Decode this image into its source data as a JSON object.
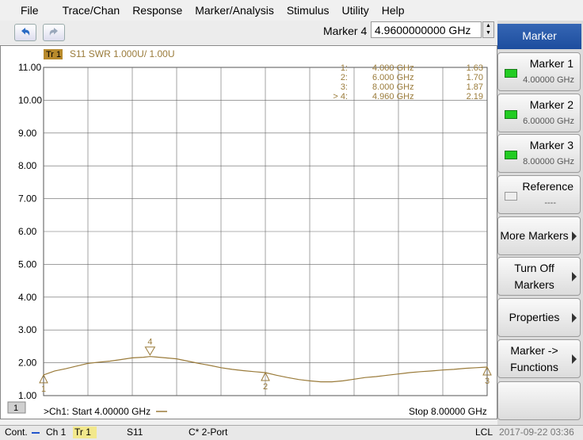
{
  "menu": [
    "File",
    "Trace/Chan",
    "Response",
    "Marker/Analysis",
    "Stimulus",
    "Utility",
    "Help"
  ],
  "toolbar": {
    "undo_icon": "undo-arrow-icon",
    "redo_icon": "redo-arrow-icon",
    "marker_label": "Marker 4",
    "marker_value": "4.9600000000 GHz"
  },
  "sidebar": {
    "title": "Marker",
    "buttons": [
      {
        "label": "Marker 1",
        "sub": "4.00000 GHz",
        "led": "on"
      },
      {
        "label": "Marker 2",
        "sub": "6.00000 GHz",
        "led": "on"
      },
      {
        "label": "Marker 3",
        "sub": "8.00000 GHz",
        "led": "on"
      },
      {
        "label": "Reference",
        "sub": "----",
        "led": "off"
      },
      {
        "label": "More Markers"
      },
      {
        "label": "Turn Off\nMarkers"
      },
      {
        "label": "Properties"
      },
      {
        "label": "Marker ->\nFunctions"
      },
      {
        "label": ""
      }
    ]
  },
  "trace": {
    "tag": "Tr 1",
    "description": "S11 SWR 1.000U/  1.00U",
    "channel_num": "1"
  },
  "marker_table": [
    {
      "id": "1:",
      "freq": "4.000 GHz",
      "val": "1.63"
    },
    {
      "id": "2:",
      "freq": "6.000 GHz",
      "val": "1.70"
    },
    {
      "id": "3:",
      "freq": "8.000 GHz",
      "val": "1.87"
    },
    {
      "id": "> 4:",
      "freq": "4.960 GHz",
      "val": "2.19"
    }
  ],
  "footer": {
    "start": ">Ch1:  Start  4.00000 GHz",
    "stop": "Stop  8.00000 GHz"
  },
  "status": {
    "mode": "Cont.",
    "ch": "Ch 1",
    "tr": "Tr 1",
    "param": "S11",
    "cal": "C* 2-Port",
    "lcl": "LCL",
    "time": "2017-09-22 03:36"
  },
  "chart_data": {
    "type": "line",
    "title": "",
    "xlabel": "",
    "ylabel": "",
    "xlim": [
      4.0,
      8.0
    ],
    "ylim": [
      1.0,
      11.0
    ],
    "yticks": [
      "11.00",
      "10.00",
      "9.00",
      "8.00",
      "7.00",
      "6.00",
      "5.00",
      "4.00",
      "3.00",
      "2.00",
      "1.00"
    ],
    "grid": true,
    "series": [
      {
        "x": [
          4.0,
          4.1,
          4.2,
          4.3,
          4.4,
          4.5,
          4.6,
          4.7,
          4.8,
          4.9,
          4.96,
          5.0,
          5.1,
          5.2,
          5.3,
          5.4,
          5.5,
          5.6,
          5.7,
          5.8,
          5.9,
          6.0,
          6.1,
          6.2,
          6.3,
          6.4,
          6.5,
          6.6,
          6.7,
          6.8,
          6.9,
          7.0,
          7.1,
          7.2,
          7.3,
          7.4,
          7.5,
          7.6,
          7.7,
          7.8,
          7.9,
          8.0
        ],
        "values": [
          1.63,
          1.75,
          1.82,
          1.9,
          1.98,
          2.02,
          2.05,
          2.1,
          2.15,
          2.17,
          2.19,
          2.18,
          2.15,
          2.12,
          2.05,
          1.98,
          1.92,
          1.85,
          1.8,
          1.76,
          1.73,
          1.7,
          1.62,
          1.55,
          1.49,
          1.45,
          1.42,
          1.42,
          1.45,
          1.5,
          1.55,
          1.58,
          1.62,
          1.66,
          1.7,
          1.73,
          1.75,
          1.78,
          1.8,
          1.83,
          1.85,
          1.87
        ]
      }
    ],
    "markers": [
      {
        "label": "1",
        "x": 4.0,
        "y": 1.63
      },
      {
        "label": "2",
        "x": 6.0,
        "y": 1.7
      },
      {
        "label": "3",
        "x": 8.0,
        "y": 1.87
      },
      {
        "label": "4",
        "x": 4.96,
        "y": 2.19
      }
    ],
    "trace_color": "#9a7b3a"
  }
}
